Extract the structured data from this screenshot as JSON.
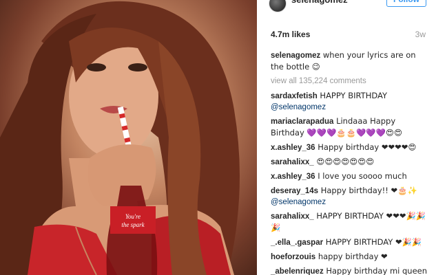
{
  "header": {
    "username": "selenagomez",
    "follow_label": "Follow"
  },
  "stats": {
    "likes": "4.7m likes",
    "time": "3w"
  },
  "caption": {
    "user": "selenagomez",
    "text": " when your lyrics are on the bottle 😉"
  },
  "view_all": "view all 135,224 comments",
  "comments": [
    {
      "user": "sardaxfetish",
      "text": " HAPPY BIRTHDAY",
      "mention": "@selenagomez"
    },
    {
      "user": "mariaclarapadua",
      "text": " Lindaaa Happy Birthday 💜💜💜🎂🎂💜💜💜😍😍"
    },
    {
      "user": "x.ashley_36",
      "text": " Happy birthday ❤❤❤❤😍"
    },
    {
      "user": "sarahalixx_",
      "text": " 😍😍😍😍😍😍😍"
    },
    {
      "user": "x.ashley_36",
      "text": " I love you soooo much"
    },
    {
      "user": "deseray_14s",
      "text": " Happy birthday!! ❤🎂✨",
      "mention": "@selenagomez"
    },
    {
      "user": "sarahalixx_",
      "text": " HAPPY BIRTHDAY ❤❤❤🎉🎉🎉"
    },
    {
      "user": "_.ella_.gaspar",
      "text": " HAPPY BIRTHDAY ❤🎉🎉"
    },
    {
      "user": "hoeforzouis",
      "text": " happy birthday ❤"
    },
    {
      "user": "_abelenriquez",
      "text": " Happy birthday mi queen"
    }
  ]
}
